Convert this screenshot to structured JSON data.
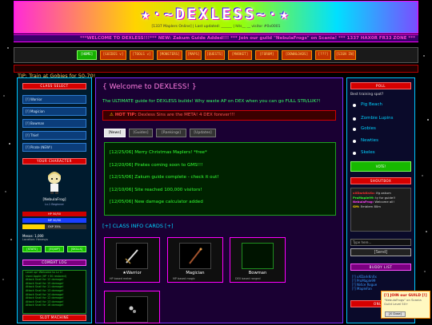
{
  "banner": {
    "title": "★·~DEXLESS~·★",
    "subtitle": "[1337 Maplers Online] | Last updated: ______ | hits__ __ visitor #0x0001"
  },
  "marquee": "***WELCOME TO DEXLESS!!!*** NEW: Zakum Guide Added!!! *** Join our guild \"NebulaFrogs\" on Scania! *** 1337 HAX0R FR33 ZONE ***",
  "nav": [
    "[HOME]",
    "[GUIDES v]",
    "[TOOLS v]",
    "[MONSTERS]",
    "[MAPS]",
    "[QUESTS]",
    "[MARKET]",
    "[FORUM]",
    "[DOWNLOADS]",
    "[???]",
    "[SIGN IN]"
  ],
  "tip_bar": "TIP: Train at Gobies for 50-70!",
  "left": {
    "class_select_header": "CLASS SELECT",
    "classes": [
      "[!] Warrior",
      "[!] Magician",
      "[!] Bowman",
      "[!] Thief",
      "[!] Pirate (NEW!)"
    ],
    "character_header": "YOUR CHARACTER",
    "char_name": "[NebulaFrog]",
    "char_level": "Lv.1 Beginner",
    "hp": "HP 50/50",
    "mp": "MP 50/50",
    "exp": "EXP 35%",
    "mesos": "Mesos: 1,000",
    "location": "Location: Henesys",
    "buttons": [
      "[STATS]",
      "[EQUIP]",
      "[SKILLS]"
    ],
    "combat_log_header": "COMBAT LOG",
    "combat_log": [
      "Level up! Welcome to Lv 1!",
      "Used Apple (HP +30 restored)",
      "Attack Snail for 12 damage!",
      "Attack Snail for 15 damage!",
      "Attack Snail for 11 damage!",
      "Attack Snail for 13 damage!",
      "Attack Snail for 14 damage!",
      "Attack Snail for 12 damage!",
      "Attack Snail for 13 damage!",
      "Attack Snail for 16 damage!"
    ],
    "slot_machine_header": "SLOT MACHINE"
  },
  "main": {
    "welcome": "{ Welcome to DEXLESS! }",
    "intro": "The ULTIMATE guide for DEXLESS builds! Why waste AP on DEX when you can go FULL STR/LUK?!",
    "hot_tip_label": "HOT TIP:",
    "hot_tip_text": "Dexless Sins are the META! 4 DEX forever!!!",
    "tabs": [
      "[News]",
      "[Guides]",
      "[Rankings]",
      "[Updates]"
    ],
    "news": [
      "[12/25/06] Merry Christmas Maplers! *free*",
      "[12/20/06] Pirates coming soon to GMS!!!",
      "[12/15/06] Zakum guide complete - check it out!",
      "[12/10/06] Site reached 100,000 visitors!",
      "[12/05/06] New damage calculator added"
    ],
    "cards_heading": "[+] CLASS INFO CARDS [+]",
    "cards": [
      {
        "name": "★Warrior",
        "lvl": "HP based melee"
      },
      {
        "name": "Magician",
        "lvl": "MP based magic"
      },
      {
        "name": "Bowman",
        "lvl": "DEX based ranged"
      },
      {
        "name": "",
        "lvl": ""
      }
    ]
  },
  "right": {
    "poll_header": "POLL",
    "poll_question": "Best training spot?",
    "poll_options": [
      "Pig Beach",
      "Zombie Lupins",
      "Gobies",
      "Newties",
      "Skeles"
    ],
    "vote_button": "VOTE!",
    "shoutbox_header": "SHOUTBOX",
    "shouts": [
      {
        "user": "xXDarkKnXx:",
        "msg": "lfg zakum"
      },
      {
        "user": "ProMaple99:",
        "msg": "ty for guide!!"
      },
      {
        "user": "NebulaFrog:",
        "msg": "Welcome all!"
      },
      {
        "user": "GM:",
        "msg": "Emblem 80m"
      }
    ],
    "shout_placeholder": "Type here...",
    "send_button": "[Send]",
    "buddy_header": "BUDDY LIST",
    "buddies": [
      "[!] xXDarkKnXx",
      "[!] ProMaple99",
      "[!] Ni4ce Rogue",
      "[!] MapleFan"
    ],
    "online_header": "ONLINE"
  },
  "popup": {
    "title": "[!] JOIN our GUILD [!]",
    "text": "\"NebulaFrogs\" on Scania",
    "sub": "Guild Level 50+",
    "button": "[X Close]"
  },
  "colors": {
    "accent_pink": "#ff00ff",
    "accent_cyan": "#00c8ff",
    "news_green": "#33ff33",
    "header_red": "#d50000"
  }
}
